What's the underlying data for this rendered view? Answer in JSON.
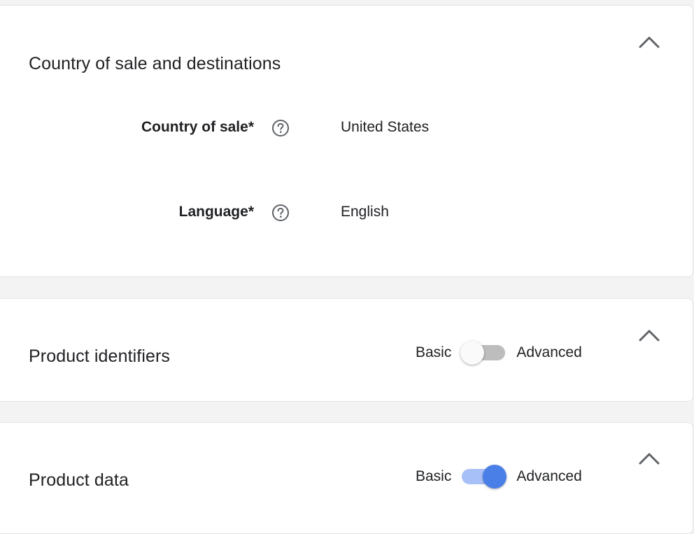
{
  "sections": {
    "country": {
      "title": "Country of sale and destinations",
      "fields": {
        "country_label": "Country of sale*",
        "country_value": "United States",
        "language_label": "Language*",
        "language_value": "English"
      }
    },
    "identifiers": {
      "title": "Product identifiers",
      "toggle_left": "Basic",
      "toggle_right": "Advanced",
      "toggle_state": "off"
    },
    "product_data": {
      "title": "Product data",
      "toggle_left": "Basic",
      "toggle_right": "Advanced",
      "toggle_state": "on"
    }
  },
  "icons": {
    "collapse": "chevron-up-icon",
    "help": "help-circle-icon"
  },
  "colors": {
    "toggle_on_thumb": "#4a7fe8",
    "toggle_on_track": "#a8c0f8",
    "toggle_off_thumb": "#fafafa",
    "toggle_off_track": "#bdbdbd"
  }
}
